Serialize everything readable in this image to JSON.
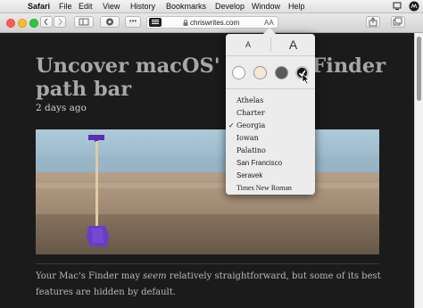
{
  "menubar": {
    "items": [
      "Safari",
      "File",
      "Edit",
      "View",
      "History",
      "Bookmarks",
      "Develop",
      "Window",
      "Help"
    ]
  },
  "toolbar": {
    "url": "chriswrites.com",
    "font_size_button": "AA",
    "more_label": "•••"
  },
  "article": {
    "title": "Uncover macOS' hidden Finder path bar",
    "date": "2 days ago",
    "body_pre": "Your Mac's Finder may ",
    "body_em": "seem",
    "body_post": " relatively straightforward, but some of its best features are hidden by default."
  },
  "popover": {
    "size_small": "A",
    "size_large": "A",
    "themes": [
      {
        "name": "white",
        "color": "#ffffff"
      },
      {
        "name": "sepia",
        "color": "#f4e9d2"
      },
      {
        "name": "gray",
        "color": "#5a5a5a"
      },
      {
        "name": "night",
        "color": "#141414",
        "selected": true
      }
    ],
    "fonts": [
      "Athelas",
      "Charter",
      "Georgia",
      "Iowan",
      "Palatino",
      "San Francisco",
      "Seravek",
      "Times New Roman"
    ],
    "selected_font": "Georgia",
    "check_mark": "✓"
  }
}
